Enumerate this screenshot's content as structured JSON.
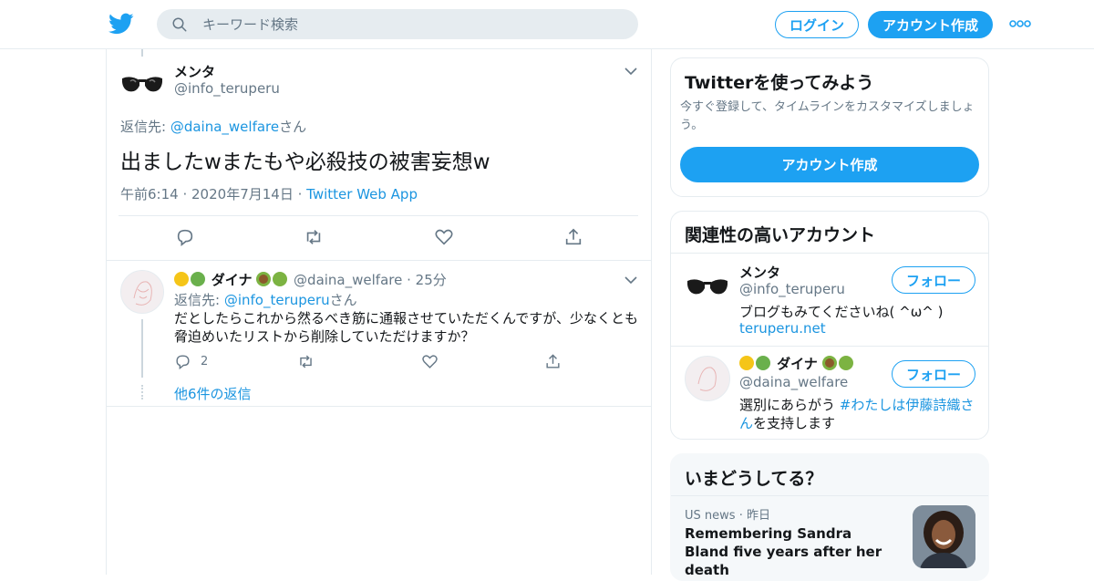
{
  "search": {
    "placeholder": "キーワード検索"
  },
  "header": {
    "login_label": "ログイン",
    "signup_label": "アカウント作成"
  },
  "main_tweet": {
    "name": "メンタ",
    "handle": "@info_teruperu",
    "reply_prefix": "返信先: ",
    "reply_to": "@daina_welfare",
    "reply_suffix": "さん",
    "text": "出ましたwまたもや必殺技の被害妄想w",
    "time": "午前6:14",
    "date": "2020年7月14日",
    "source": "Twitter Web App"
  },
  "reply_tweet": {
    "name": "ダイナ",
    "handle": "@daina_welfare",
    "age": "25分",
    "reply_prefix": "返信先: ",
    "reply_to": "@info_teruperu",
    "reply_suffix": "さん",
    "text": "だとしたらこれから然るべき筋に通報させていただくんですが、少なくとも脅迫めいたリストから削除していただけますか？",
    "reply_count": "2",
    "more_replies": "他6件の返信"
  },
  "sidebar": {
    "signup_card": {
      "title": "Twitterを使ってみよう",
      "description": "今すぐ登録して、タイムラインをカスタマイズしましょう。",
      "button_label": "アカウント作成"
    },
    "relevant": {
      "title": "関連性の高いアカウント",
      "follow_label": "フォロー",
      "accounts": [
        {
          "name": "メンタ",
          "handle": "@info_teruperu",
          "bio": "ブログもみてくださいね( ^ω^ )",
          "link": "teruperu.net"
        },
        {
          "name": "ダイナ",
          "handle": "@daina_welfare",
          "bio_prefix": "選別にあらがう ",
          "hashtag": "#わたしは伊藤詩織さん",
          "bio_suffix": "を支持します"
        }
      ]
    },
    "trends": {
      "title": "いまどうしてる？",
      "items": [
        {
          "category": "US news",
          "age": "昨日",
          "headline": "Remembering Sandra Bland five years after her death"
        }
      ]
    }
  },
  "colors": {
    "accent": "#1da1f2",
    "link": "#1b95e0",
    "border": "#e6ecf0",
    "muted": "#657786"
  }
}
